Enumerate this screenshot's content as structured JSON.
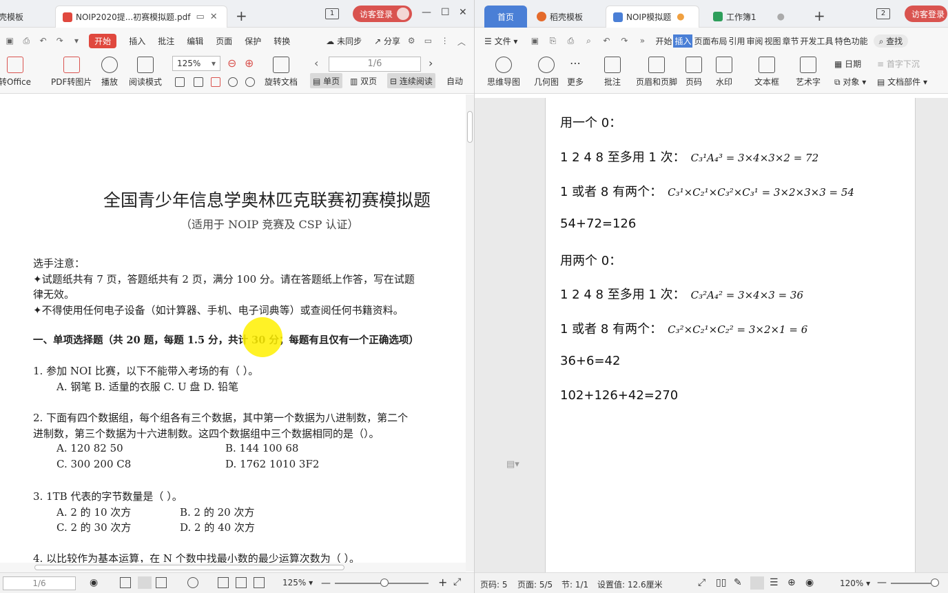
{
  "left": {
    "tabs": [
      {
        "label": "稻壳模板"
      },
      {
        "label": "NOIP2020提...初赛模拟题.pdf"
      }
    ],
    "tab_count": "1",
    "visitor": "访客登录",
    "menus": [
      "开始",
      "插入",
      "批注",
      "编辑",
      "页面",
      "保护",
      "转换"
    ],
    "sync": "未同步",
    "share": "分享",
    "tools": {
      "to_office": "转Office",
      "pdf_to_img": "PDF转图片",
      "play": "播放",
      "read_mode": "阅读模式",
      "rotate": "旋转文档",
      "single": "单页",
      "double": "双页",
      "continuous": "连续阅读",
      "auto": "自动"
    },
    "zoom": "125%",
    "page_input": "1/6",
    "status": {
      "page": "1/6",
      "zoom": "125%"
    },
    "doc": {
      "title": "全国青少年信息学奥林匹克联赛初赛模拟题",
      "subtitle": "（适用于 NOIP 竞赛及 CSP 认证）",
      "notice_head": "选手注意：",
      "notice1": "✦试题纸共有 7 页，答题纸共有 2 页，满分 100 分。请在答题纸上作答，写在试题",
      "notice1b": "律无效。",
      "notice2": "✦不得使用任何电子设备（如计算器、手机、电子词典等）或查阅任何书籍资料。",
      "section": "一、单项选择题（共 20 题，每题 1.5 分，共计 30 分；每题有且仅有一个正确选项）",
      "q1": "1. 参加 NOI 比赛，以下不能带入考场的有（ ）。",
      "q1_opts": "A.  钢笔     B.  适量的衣服     C.  U 盘     D.  铅笔",
      "q2": "2. 下面有四个数据组，每个组各有三个数据，其中第一个数据为八进制数，第二个",
      "q2b": "进制数，第三个数据为十六进制数。这四个数据组中三个数据相同的是（）。",
      "q2_a": "A.  120  82  50",
      "q2_b": "B.  144  100  68",
      "q2_c": "C.  300  200  C8",
      "q2_d": "D.  1762  1010  3F2",
      "q3": "3. 1TB 代表的字节数量是（ ）。",
      "q3_a": "A. 2 的 10 次方",
      "q3_b": "B. 2 的 20 次方",
      "q3_c": "C. 2 的 30 次方",
      "q3_d": "D. 2 的 40 次方",
      "q4": "4. 以比较作为基本运算，在 N 个数中找最小数的最少运算次数为（ ）。"
    }
  },
  "right": {
    "tabs": [
      {
        "label": "首页"
      },
      {
        "label": "稻壳模板"
      },
      {
        "label": "NOIP模拟题"
      },
      {
        "label": "工作簿1"
      }
    ],
    "tab_count": "2",
    "visitor": "访客登录",
    "menus": [
      "文件",
      "开始",
      "插入",
      "页面布局",
      "引用",
      "审阅",
      "视图",
      "章节",
      "开发工具",
      "特色功能"
    ],
    "search": "查找",
    "tools": [
      "思维导图",
      "几何图",
      "更多",
      "批注",
      "页眉和页脚",
      "页码",
      "水印",
      "文本框",
      "艺术字",
      "日期",
      "对象",
      "首字下沉",
      "文档部件"
    ],
    "doc_lines": [
      {
        "text": "用一个 0：",
        "formula": ""
      },
      {
        "text": "1 2 4 8 至多用 1 次：",
        "formula": "C₃¹A₄³ = 3×4×3×2 = 72"
      },
      {
        "text": "1 或者 8 有两个：",
        "formula": "C₃¹×C₂¹×C₃²×C₃¹ = 3×2×3×3 = 54"
      },
      {
        "text": "54+72=126",
        "formula": ""
      },
      {
        "text": "用两个 0：",
        "formula": ""
      },
      {
        "text": "1 2 4 8 至多用 1 次：",
        "formula": "C₃²A₄² = 3×4×3 = 36"
      },
      {
        "text": "1 或者 8 有两个：",
        "formula": "C₃²×C₂¹×C₂² = 3×2×1 = 6"
      },
      {
        "text": "36+6=42",
        "formula": ""
      },
      {
        "text": "102+126+42=270",
        "formula": ""
      }
    ],
    "status": {
      "page_no": "页码: 5",
      "pages": "页面: 5/5",
      "section": "节: 1/1",
      "setting": "设置值: 12.6厘米",
      "zoom": "120%"
    }
  }
}
